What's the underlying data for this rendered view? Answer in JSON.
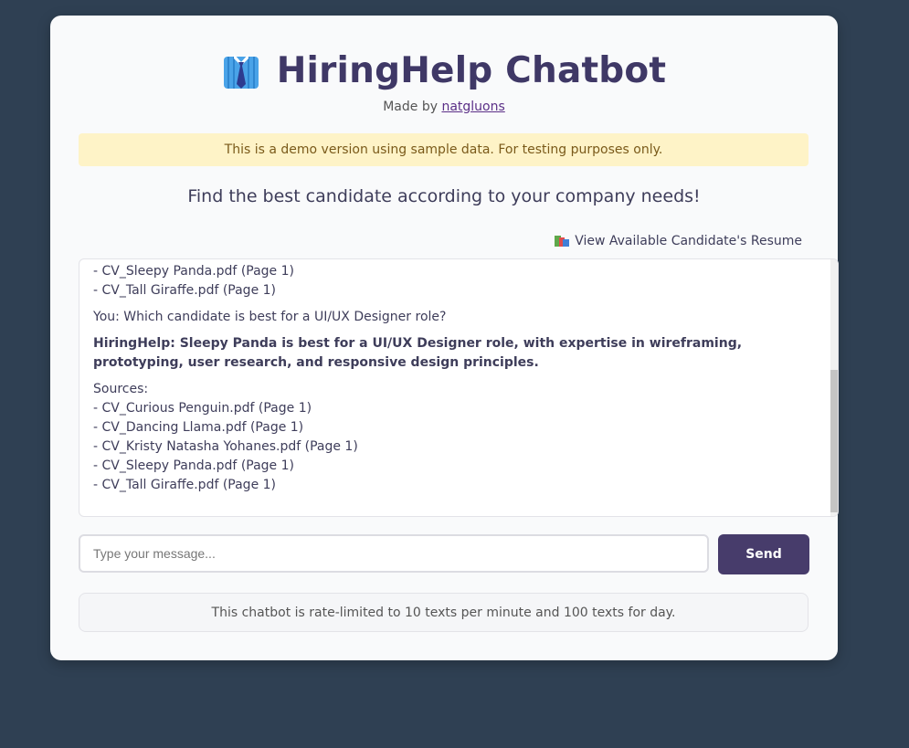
{
  "header": {
    "logo_icon": "necktie-shirt-icon",
    "title": "HiringHelp Chatbot",
    "made_by_prefix": "Made by",
    "author_link": "natgluons"
  },
  "demo_banner": "This is a demo version using sample data. For testing purposes only.",
  "tagline": "Find the best candidate according to your company needs!",
  "resume_link": {
    "icon": "books-icon",
    "label": "View Available Candidate's Resume"
  },
  "chat": {
    "earlier_sources_tail": [
      "- CV_Sleepy Panda.pdf (Page 1)",
      "- CV_Tall Giraffe.pdf (Page 1)"
    ],
    "user_message": "You: Which candidate is best for a UI/UX Designer role?",
    "bot_message": "HiringHelp: Sleepy Panda is best for a UI/UX Designer role, with expertise in wireframing, prototyping, user research, and responsive design principles.",
    "sources_label": "Sources:",
    "sources": [
      "- CV_Curious Penguin.pdf (Page 1)",
      "- CV_Dancing Llama.pdf (Page 1)",
      "- CV_Kristy Natasha Yohanes.pdf (Page 1)",
      "- CV_Sleepy Panda.pdf (Page 1)",
      "- CV_Tall Giraffe.pdf (Page 1)"
    ]
  },
  "input": {
    "placeholder": "Type your message...",
    "value": ""
  },
  "send_button": "Send",
  "rate_limit_note": "This chatbot is rate-limited to 10 texts per minute and 100 texts for day.",
  "colors": {
    "page_bg": "#2f4053",
    "title": "#3f3866",
    "send_button_bg": "#473c6b",
    "banner_bg": "#fef3c7"
  }
}
